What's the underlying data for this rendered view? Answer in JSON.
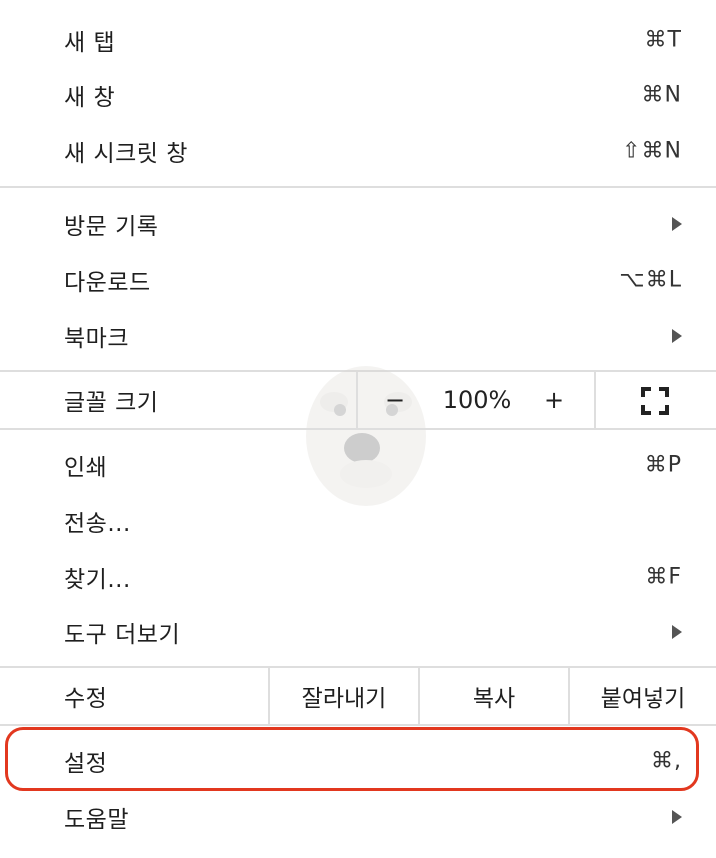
{
  "menu": {
    "group1": [
      {
        "label": "새 탭",
        "shortcut": "⌘T"
      },
      {
        "label": "새 창",
        "shortcut": "⌘N"
      },
      {
        "label": "새 시크릿 창",
        "shortcut": "⇧⌘N"
      }
    ],
    "group2": [
      {
        "label": "방문 기록",
        "submenu": true
      },
      {
        "label": "다운로드",
        "shortcut": "⌥⌘L"
      },
      {
        "label": "북마크",
        "submenu": true
      }
    ],
    "zoom": {
      "label": "글꼴 크기",
      "minus": "−",
      "value": "100%",
      "plus": "+",
      "fullscreen_icon": "fullscreen-icon"
    },
    "group3": [
      {
        "label": "인쇄",
        "shortcut": "⌘P"
      },
      {
        "label": "전송...",
        "shortcut": ""
      },
      {
        "label": "찾기...",
        "shortcut": "⌘F"
      },
      {
        "label": "도구 더보기",
        "submenu": true
      }
    ],
    "edit": {
      "label": "수정",
      "cut": "잘라내기",
      "copy": "복사",
      "paste": "붙여넣기"
    },
    "group4": [
      {
        "label": "설정",
        "shortcut": "⌘,"
      },
      {
        "label": "도움말",
        "submenu": true
      }
    ]
  },
  "colors": {
    "highlight": "#e2381f",
    "separator": "#dedede"
  }
}
